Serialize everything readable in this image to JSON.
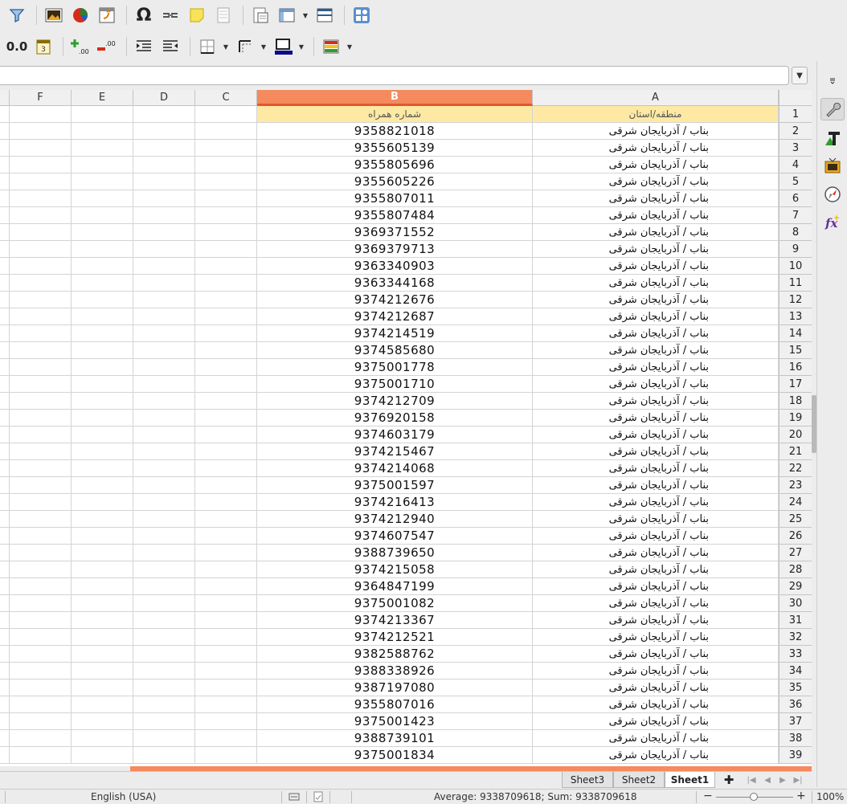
{
  "toolbar1": {
    "icons": [
      "autofilter-icon",
      "insert-image-icon",
      "insert-chart-icon",
      "insert-pivot-table-icon",
      "special-character-icon",
      "hyperlink-icon",
      "comment-icon",
      "header-footer-icon",
      "define-print-area-icon",
      "freeze-rows-columns-icon",
      "split-window-icon",
      "show-draw-functions-icon"
    ]
  },
  "toolbar2": {
    "number_format_label": "0.0",
    "icons": [
      "number-format-date-icon",
      "add-decimal-place-icon",
      "delete-decimal-place-icon",
      "increase-indent-icon",
      "decrease-indent-icon",
      "borders-icon",
      "border-style-icon",
      "border-color-icon",
      "conditional-format-icon"
    ]
  },
  "grid": {
    "columns": [
      "F",
      "E",
      "D",
      "C",
      "B",
      "A"
    ],
    "active_column": "B",
    "header_row": {
      "row": "1",
      "A": "منطقه/استان",
      "B": "شماره همراه"
    },
    "region_text": "بناب / آذربایجان شرقی",
    "rows": [
      {
        "row": "2",
        "phone": "9358821018"
      },
      {
        "row": "3",
        "phone": "9355605139"
      },
      {
        "row": "4",
        "phone": "9355805696"
      },
      {
        "row": "5",
        "phone": "9355605226"
      },
      {
        "row": "6",
        "phone": "9355807011"
      },
      {
        "row": "7",
        "phone": "9355807484"
      },
      {
        "row": "8",
        "phone": "9369371552"
      },
      {
        "row": "9",
        "phone": "9369379713"
      },
      {
        "row": "10",
        "phone": "9363340903"
      },
      {
        "row": "11",
        "phone": "9363344168"
      },
      {
        "row": "12",
        "phone": "9374212676"
      },
      {
        "row": "13",
        "phone": "9374212687"
      },
      {
        "row": "14",
        "phone": "9374214519"
      },
      {
        "row": "15",
        "phone": "9374585680"
      },
      {
        "row": "16",
        "phone": "9375001778"
      },
      {
        "row": "17",
        "phone": "9375001710"
      },
      {
        "row": "18",
        "phone": "9374212709"
      },
      {
        "row": "19",
        "phone": "9376920158"
      },
      {
        "row": "20",
        "phone": "9374603179"
      },
      {
        "row": "21",
        "phone": "9374215467"
      },
      {
        "row": "22",
        "phone": "9374214068"
      },
      {
        "row": "23",
        "phone": "9375001597"
      },
      {
        "row": "24",
        "phone": "9374216413"
      },
      {
        "row": "25",
        "phone": "9374212940"
      },
      {
        "row": "26",
        "phone": "9374607547"
      },
      {
        "row": "27",
        "phone": "9388739650"
      },
      {
        "row": "28",
        "phone": "9374215058"
      },
      {
        "row": "29",
        "phone": "9364847199"
      },
      {
        "row": "30",
        "phone": "9375001082"
      },
      {
        "row": "31",
        "phone": "9374213367"
      },
      {
        "row": "32",
        "phone": "9374212521"
      },
      {
        "row": "33",
        "phone": "9382588762"
      },
      {
        "row": "34",
        "phone": "9388338926"
      },
      {
        "row": "35",
        "phone": "9387197080"
      },
      {
        "row": "36",
        "phone": "9355807016"
      },
      {
        "row": "37",
        "phone": "9375001423"
      },
      {
        "row": "38",
        "phone": "9388739101"
      },
      {
        "row": "39",
        "phone": "9375001834"
      }
    ]
  },
  "sheet_tabs": [
    {
      "label": "Sheet3",
      "active": false
    },
    {
      "label": "Sheet2",
      "active": false
    },
    {
      "label": "Sheet1",
      "active": true
    }
  ],
  "statusbar": {
    "language": "English (USA)",
    "summary": "Average: 9338709618; Sum: 9338709618",
    "zoom": "100%",
    "zoom_minus": "−",
    "zoom_plus": "+"
  },
  "sidebar": {
    "icons": [
      "sidebar-menu-icon",
      "properties-icon",
      "styles-icon",
      "gallery-icon",
      "navigator-icon",
      "functions-icon"
    ]
  },
  "colors": {
    "active_header": "#f58a5e",
    "header_row_fill": "#fde9a4"
  }
}
